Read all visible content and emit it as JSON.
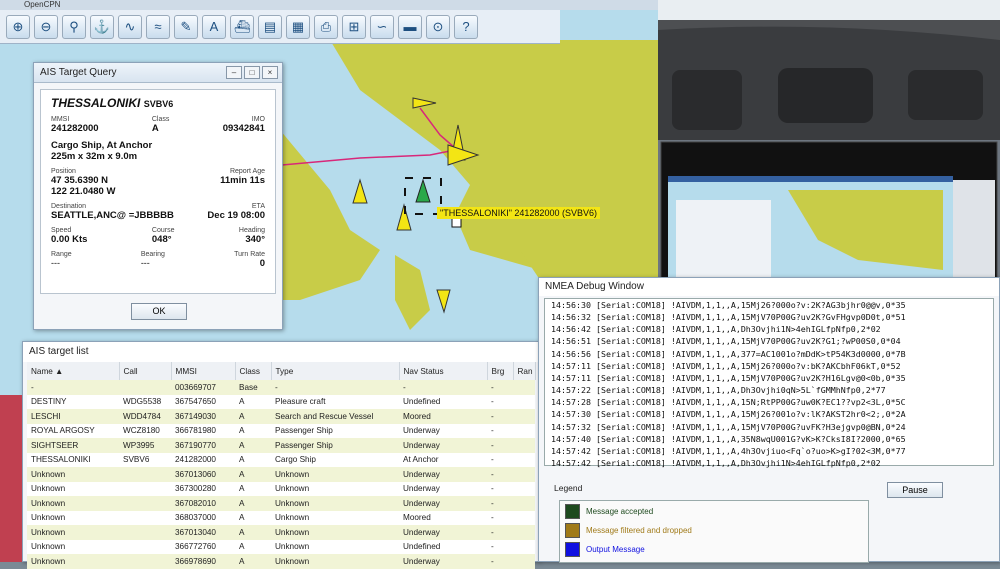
{
  "app_title": "OpenCPN",
  "colors": {
    "water": "#b6dcec",
    "land": "#c8cc48",
    "accent_yellow": "#f3e514",
    "track": "#d8287a"
  },
  "toolbar_icons": [
    "zoom-in-icon",
    "zoom-out-icon",
    "filter-icon",
    "anchor-icon",
    "route-icon",
    "tide-icon",
    "tools-icon",
    "text-icon",
    "ship-icon",
    "layers-icon",
    "chart-icon",
    "print-icon",
    "grid-icon",
    "track-icon",
    "settings-icon",
    "center-icon",
    "help-icon"
  ],
  "ship_label": "\"THESSALONIKI\" 241282000 (SVBV6)",
  "query": {
    "title": "AIS Target Query",
    "name": "THESSALONIKI",
    "callsign": "SVBV6",
    "mmsi_label": "MMSI",
    "mmsi": "241282000",
    "class_label": "Class",
    "class": "A",
    "imo_label": "IMO",
    "imo": "09342841",
    "type": "Cargo Ship, At Anchor",
    "dims": "225m x 32m x 9.0m",
    "position_label": "Position",
    "lat": "47 35.6390 N",
    "lon": "122 21.0480 W",
    "report_label": "Report Age",
    "report": "11min 11s",
    "dest_label": "Destination",
    "dest": "SEATTLE,ANC@ =JBBBBB",
    "eta_label": "ETA",
    "eta": "Dec 19 08:00",
    "speed_label": "Speed",
    "speed": "0.00 Kts",
    "course_label": "Course",
    "course": "048°",
    "heading_label": "Heading",
    "heading": "340°",
    "range_label": "Range",
    "range": "---",
    "bearing_label": "Bearing",
    "bearing": "---",
    "turn_label": "Turn Rate",
    "turn": "0",
    "ok": "OK"
  },
  "target_list": {
    "title": "AIS target list",
    "columns": [
      "Name ▲",
      "Call",
      "MMSI",
      "Class",
      "Type",
      "Nav Status",
      "Brg",
      "Ran"
    ],
    "rows": [
      [
        "-",
        "",
        "003669707",
        "Base",
        "-",
        "-",
        "-"
      ],
      [
        "DESTINY",
        "WDG5538",
        "367547650",
        "A",
        "Pleasure craft",
        "Undefined",
        "-"
      ],
      [
        "LESCHI",
        "WDD4784",
        "367149030",
        "A",
        "Search and Rescue Vessel",
        "Moored",
        "-"
      ],
      [
        "ROYAL ARGOSY",
        "WCZ8180",
        "366781980",
        "A",
        "Passenger Ship",
        "Underway",
        "-"
      ],
      [
        "SIGHTSEER",
        "WP3995",
        "367190770",
        "A",
        "Passenger Ship",
        "Underway",
        "-"
      ],
      [
        "THESSALONIKI",
        "SVBV6",
        "241282000",
        "A",
        "Cargo Ship",
        "At Anchor",
        "-"
      ],
      [
        "Unknown",
        "",
        "367013060",
        "A",
        "Unknown",
        "Underway",
        "-"
      ],
      [
        "Unknown",
        "",
        "367300280",
        "A",
        "Unknown",
        "Underway",
        "-"
      ],
      [
        "Unknown",
        "",
        "367082010",
        "A",
        "Unknown",
        "Underway",
        "-"
      ],
      [
        "Unknown",
        "",
        "368037000",
        "A",
        "Unknown",
        "Moored",
        "-"
      ],
      [
        "Unknown",
        "",
        "367013040",
        "A",
        "Unknown",
        "Underway",
        "-"
      ],
      [
        "Unknown",
        "",
        "366772760",
        "A",
        "Unknown",
        "Undefined",
        "-"
      ],
      [
        "Unknown",
        "",
        "366978690",
        "A",
        "Unknown",
        "Underway",
        "-"
      ]
    ]
  },
  "nmea": {
    "title": "NMEA Debug Window",
    "lines": [
      "14:56:30 [Serial:COM18] !AIVDM,1,1,,A,15Mj26?000o?v:2K?AG3bjhr0@@v,0*35",
      "14:56:32 [Serial:COM18] !AIVDM,1,1,,A,15MjV70P00G?uv2K?GvFHgvp0D0t,0*51",
      "14:56:42 [Serial:COM18] !AIVDM,1,1,,A,Dh3Ovjhi1N>4ehIGLfpNfp0,2*02",
      "14:56:51 [Serial:COM18] !AIVDM,1,1,,A,15MjV70P00G?uv2K?G1;?wP00S0,0*04",
      "14:56:56 [Serial:COM18] !AIVDM,1,1,,A,377=AC1001o?mDdK>tP54K3d0000,0*7B",
      "14:57:11 [Serial:COM18] !AIVDM,1,1,,A,15Mj26?000o?v:bK?AKCbhF06kT,0*52",
      "14:57:11 [Serial:COM18] !AIVDM,1,1,,A,15MjV70P00G?uv2K?H16Lgv@0<0b,0*35",
      "14:57:22 [Serial:COM18] !AIVDM,1,1,,A,Dh3Ovjhi0qN>5L`fGMMhNfp0,2*77",
      "14:57:28 [Serial:COM18] !AIVDM,1,1,,A,15N;RtPP00G?uw0K?EC1??vp2<3L,0*5C",
      "14:57:30 [Serial:COM18] !AIVDM,1,1,,A,15Mj26?001o?v:lK?AKST2hr0<2;,0*2A",
      "14:57:32 [Serial:COM18] !AIVDM,1,1,,A,15MjV70P00G?uvFK?H3ejgvp0@BN,0*24",
      "14:57:40 [Serial:COM18] !AIVDM,1,1,,A,35N8wqU001G?vK>K?CksI8I?2000,0*65",
      "14:57:42 [Serial:COM18] !AIVDM,1,1,,A,4h3Ovjiuo<Fq`o?uo>K>gI?02<3M,0*77",
      "14:57:42 [Serial:COM18] !AIVDM,1,1,,A,Dh3Ovjhi1N>4ehIGLfpNfp0,2*02"
    ],
    "legend_label": "Legend",
    "pause": "Pause",
    "legend": [
      {
        "label": "Message accepted",
        "color": "#1e4a1e"
      },
      {
        "label": "Message filtered and dropped",
        "color": "#a07a18"
      },
      {
        "label": "Output Message",
        "color": "#1010e0"
      }
    ]
  }
}
